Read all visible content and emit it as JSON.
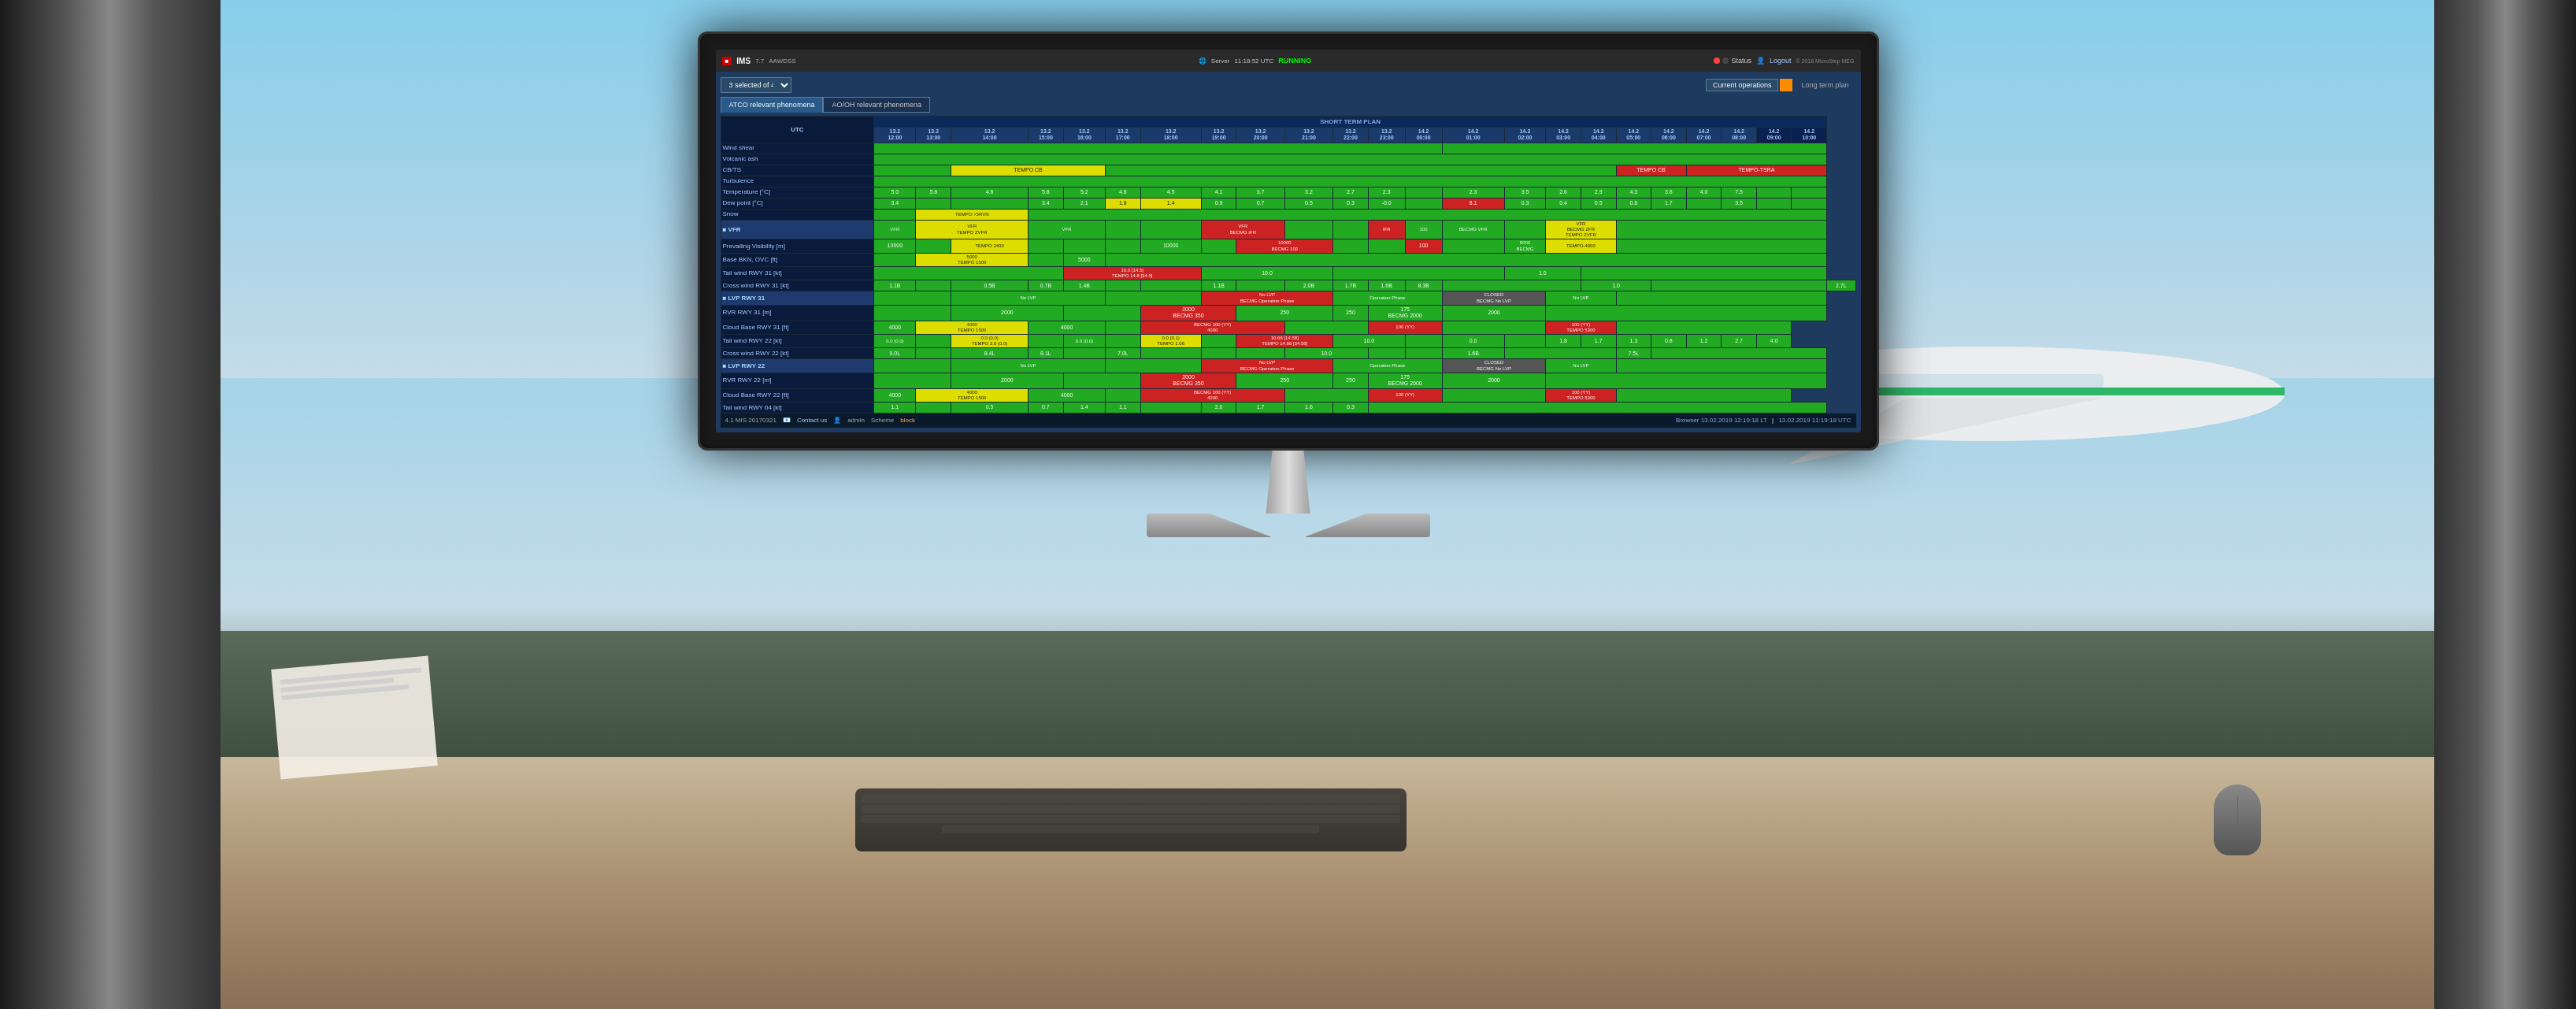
{
  "background": {
    "sky_color": "#87CEEB",
    "desk_color": "#c8b89a"
  },
  "app": {
    "title": "IMS",
    "version": "7.7",
    "subtitle": "AAWDSS",
    "server_time": "11:18:52 UTC",
    "server_status": "RUNNING",
    "status_label": "Status",
    "logout_label": "Logout",
    "copyright": "© 2018 MicroStep MEG"
  },
  "selector": {
    "value": "3 selected of 4"
  },
  "tabs": {
    "ops": [
      {
        "label": "Current operations",
        "active": false
      },
      {
        "label": "",
        "highlight": true
      },
      {
        "label": "Long term plan",
        "active": false
      }
    ],
    "phenomena": [
      {
        "label": "ATCO relevant phenomena",
        "active": true
      },
      {
        "label": "AO/OH relevant phenomena",
        "active": false
      }
    ]
  },
  "grid": {
    "short_term_plan_label": "SHORT TERM PLAN",
    "time_headers": [
      {
        "date": "13.2",
        "time": "12:00"
      },
      {
        "date": "13.2",
        "time": "13:00"
      },
      {
        "date": "13.2",
        "time": "14:00"
      },
      {
        "date": "13.2",
        "time": "15:00"
      },
      {
        "date": "13.2",
        "time": "16:00"
      },
      {
        "date": "13.2",
        "time": "17:00"
      },
      {
        "date": "13.2",
        "time": "18:00"
      },
      {
        "date": "13.2",
        "time": "19:00"
      },
      {
        "date": "13.2",
        "time": "20:00"
      },
      {
        "date": "13.2",
        "time": "21:00"
      },
      {
        "date": "13.2",
        "time": "22:00"
      },
      {
        "date": "13.2",
        "time": "23:00"
      },
      {
        "date": "14.2",
        "time": "00:00"
      },
      {
        "date": "14.2",
        "time": "01:00"
      },
      {
        "date": "14.2",
        "time": "02:00"
      },
      {
        "date": "14.2",
        "time": "03:00"
      },
      {
        "date": "14.2",
        "time": "04:00"
      },
      {
        "date": "14.2",
        "time": "05:00"
      },
      {
        "date": "14.2",
        "time": "06:00"
      },
      {
        "date": "14.2",
        "time": "07:00"
      },
      {
        "date": "14.2",
        "time": "08:00"
      },
      {
        "date": "14.2",
        "time": "09:00"
      },
      {
        "date": "14.2",
        "time": "10:00"
      }
    ],
    "rows": [
      {
        "label": "UTC",
        "type": "header"
      },
      {
        "label": "Wind shear",
        "type": "data"
      },
      {
        "label": "Volcanic ash",
        "type": "data"
      },
      {
        "label": "CB/TS",
        "type": "data",
        "cells": [
          "empty",
          "empty",
          "TEMPO CB",
          "",
          "",
          "",
          "",
          "",
          "",
          "",
          "",
          "",
          "",
          "",
          "",
          "",
          "",
          "",
          "",
          "TEMPO CB",
          "TEMPO-TSRA",
          "empty"
        ]
      },
      {
        "label": "Turbulence",
        "type": "data"
      },
      {
        "label": "Temperature [°C]",
        "type": "data",
        "cells": [
          "5.0",
          "5.8",
          "4.6",
          "5.8",
          "5.2",
          "4.8",
          "4.5",
          "4.1",
          "3.7",
          "3.2",
          "2.7",
          "2.3",
          "",
          "2.3",
          "3.5",
          "2.6",
          "2.9",
          "4.3",
          "3.6",
          "4.0",
          "7.5"
        ]
      },
      {
        "label": "Dew point [°C]",
        "type": "data",
        "cells": [
          "3.4",
          "",
          "",
          "3.4",
          "2.1",
          "1.8",
          "1.4",
          "0.9",
          "0.7",
          "0.5",
          "0.3",
          "-0.0",
          "",
          "8.1",
          "0.3",
          "0.4",
          "0.5",
          "0.8",
          "1.7",
          "",
          "3.5"
        ]
      },
      {
        "label": "Snow",
        "type": "data",
        "cells": [
          "",
          "TEMPO >5RVN",
          "",
          "",
          "",
          "",
          "",
          "",
          "",
          "",
          "",
          "",
          "",
          "",
          "",
          "",
          "",
          "",
          "",
          "",
          ""
        ]
      },
      {
        "label": "■ VFR",
        "type": "section",
        "cells": [
          "VFR",
          "VFR TEMPO ZVFR",
          "",
          "",
          "VFR",
          "",
          "",
          "VFR BECMG IFR 10000",
          "",
          "",
          "IFR",
          "100",
          "BECMG VFR",
          "VFR",
          "BECMG VFR TEMPO ZVFR",
          "",
          ""
        ]
      },
      {
        "label": "Prevailing Visibility [m]",
        "type": "data",
        "cells": [
          "10000",
          "",
          "TEMPO 2400",
          "",
          "",
          "10000",
          "",
          "",
          "10000 BECMG 100",
          "",
          "100",
          "",
          "",
          "8000 BECMG",
          "TEMPO-4000",
          ""
        ]
      },
      {
        "label": "Base BKN, OVC [ft]",
        "type": "data",
        "cells": [
          "",
          "5000 TEMPO 1500",
          "",
          "5000",
          "",
          "",
          "",
          "",
          "",
          "",
          "",
          "",
          "",
          "",
          "",
          ""
        ]
      },
      {
        "label": "Tail wind RWY 31 [kt]",
        "type": "data_green",
        "cells": [
          "",
          "",
          "",
          "",
          "10.0 [14.5] TEMPO 14.8 [34.5]",
          "",
          "10.0",
          "",
          "",
          "",
          "1.0",
          "",
          ""
        ]
      },
      {
        "label": "Cross wind RWY 31 [kt]",
        "type": "data_green",
        "cells": [
          "1.1B",
          "",
          "0.5B",
          "0.7B",
          "1.4B",
          "",
          "",
          "1.1B",
          "",
          "2.0B",
          "1.7B",
          "1.6B",
          "8.3B",
          "",
          "",
          "",
          "1.0",
          "",
          "2.7L"
        ]
      },
      {
        "label": "■ LVP RWY 31",
        "type": "section",
        "cells": [
          "",
          "No LVP",
          "",
          "",
          "No LVP BECMG Operation Phase",
          "",
          "",
          "Operation Phase",
          "CLOSED BECMG No LVP",
          "No LVP",
          ""
        ]
      },
      {
        "label": "RVR RWY 31 [m]",
        "type": "data",
        "cells": [
          "",
          "2000",
          "",
          "2000 BECMG 350",
          "",
          "250",
          "250",
          "175 BECMG 2000",
          "2000",
          ""
        ]
      },
      {
        "label": "Cloud Base RWY 31 [ft]",
        "type": "data",
        "cells": [
          "4000",
          "4000 TEMPO 1500",
          "",
          "4000",
          "",
          "BECMG 100 (YY) 4000",
          "",
          "100 (YY)",
          "",
          "100 (YY) TEMPO 5300",
          ""
        ]
      },
      {
        "label": "Tail wind RWY 22 [kt]",
        "type": "data_green",
        "cells": [
          "0.0 (0.0)",
          "",
          "0.0 (0.0) TEMPO 2.6 (0.0)",
          "",
          "0.0 (0.0)",
          "",
          "0.0 (0.1) TEMPO 1.06 (1.0-1)",
          "",
          "10.66 [14.58] TEMPO 14.88 [34.58]",
          "",
          "10.0",
          "",
          "",
          "",
          "0.0",
          "",
          "1.8",
          "1.7",
          "1.3",
          "0.8",
          "1.2",
          "2.7",
          "4.0"
        ]
      },
      {
        "label": "Cross wind RWY 22 [kt]",
        "type": "data_green",
        "cells": [
          "9.0L",
          "",
          "8.4L",
          "8.1L",
          "",
          "7.0L",
          "",
          "",
          "",
          "10.0",
          "",
          "",
          "1.6B",
          "",
          "",
          "",
          "7.5L"
        ]
      },
      {
        "label": "■ LVP RWY 22",
        "type": "section",
        "cells": [
          "",
          "No LVP",
          "",
          "",
          "No LVP BECMG Operation Phase",
          "",
          "",
          "Operation Phase",
          "CLOSED BECMG No LVP",
          "No LVP",
          ""
        ]
      },
      {
        "label": "RVR RWY 22 [m]",
        "type": "data",
        "cells": [
          "",
          "2000",
          "",
          "2000 BECMG 350",
          "",
          "250",
          "250",
          "175 BECMG 2000",
          "2000",
          ""
        ]
      },
      {
        "label": "Cloud Base RWY 22 [ft]",
        "type": "data",
        "cells": [
          "4000",
          "4000 TEMPO 1500",
          "",
          "4000",
          "",
          "BECMG 100 (YY) 4000",
          "",
          "100 (YY)",
          "",
          "100 (YY) TEMPO 5300",
          ""
        ]
      },
      {
        "label": "Tail wind RWY 04 [kt]",
        "type": "data_green",
        "cells": [
          "1.1",
          "",
          "0.5",
          "0.7",
          "1.4",
          "1.1",
          "",
          "2.0",
          "1.7",
          "1.6",
          "0.3",
          "",
          "",
          "",
          ""
        ]
      }
    ]
  },
  "status_bar": {
    "version": "4.1 MIS 20170321",
    "contact": "Contact us",
    "admin": "admin",
    "scheme_label": "Scheme",
    "scheme_value": "block",
    "browser_time": "Browser 13.02.2019 12:19:18 LT",
    "utc_time": "13.02.2019 11:19:18 UTC"
  }
}
